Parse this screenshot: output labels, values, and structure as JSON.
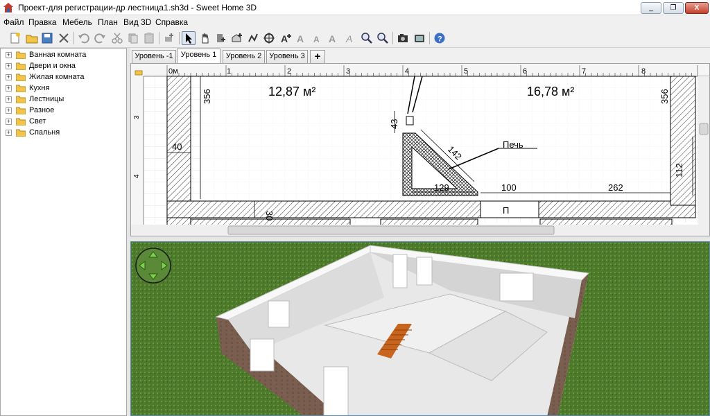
{
  "window": {
    "title": "Проект-для регистрации-др лестница1.sh3d - Sweet Home 3D",
    "minimize": "_",
    "maximize": "❐",
    "close": "X"
  },
  "menu": [
    "Файл",
    "Правка",
    "Мебель",
    "План",
    "Вид 3D",
    "Справка"
  ],
  "toolbar_icons": [
    "new-icon",
    "open-icon",
    "save-icon",
    "cut-preferences-icon",
    "undo-icon",
    "redo-icon",
    "cut-icon",
    "copy-icon",
    "paste-icon",
    "add-furniture-icon",
    "select-icon",
    "pan-icon",
    "create-walls-icon",
    "create-rooms-icon",
    "create-polylines-icon",
    "create-dimensions-icon",
    "add-text-icon",
    "increase-text-icon",
    "decrease-text-icon",
    "bold-text-icon",
    "italic-text-icon",
    "zoom-in-icon",
    "zoom-out-icon",
    "create-photo-icon",
    "create-video-icon",
    "help-icon"
  ],
  "catalog": {
    "categories": [
      "Ванная комната",
      "Двери и окна",
      "Жилая комната",
      "Кухня",
      "Лестницы",
      "Разное",
      "Свет",
      "Спальня"
    ]
  },
  "plan": {
    "tabs": [
      "Уровень -1",
      "Уровень 1",
      "Уровень 2",
      "Уровень 3",
      "+"
    ],
    "active_tab": "Уровень 1",
    "ruler_x": [
      "0м",
      "1",
      "2",
      "3",
      "4",
      "5",
      "6",
      "7",
      "8"
    ],
    "ruler_y": [
      "3",
      "4"
    ],
    "room_areas": [
      "12,87 м²",
      "16,78 м²"
    ],
    "dimensions": [
      "356",
      "356",
      "40",
      "43",
      "142",
      "129",
      "100",
      "262",
      "112",
      "30"
    ],
    "labels": {
      "stove": "Печь",
      "p_label": "П"
    }
  },
  "view3d": {
    "nav_arrows": "navigation-arrows"
  },
  "colors": {
    "grass": "#4e7a2c",
    "wall_exterior": "#7a5e4f",
    "stairs": "#c8641e",
    "selection_blue": "#3a6ea5"
  }
}
